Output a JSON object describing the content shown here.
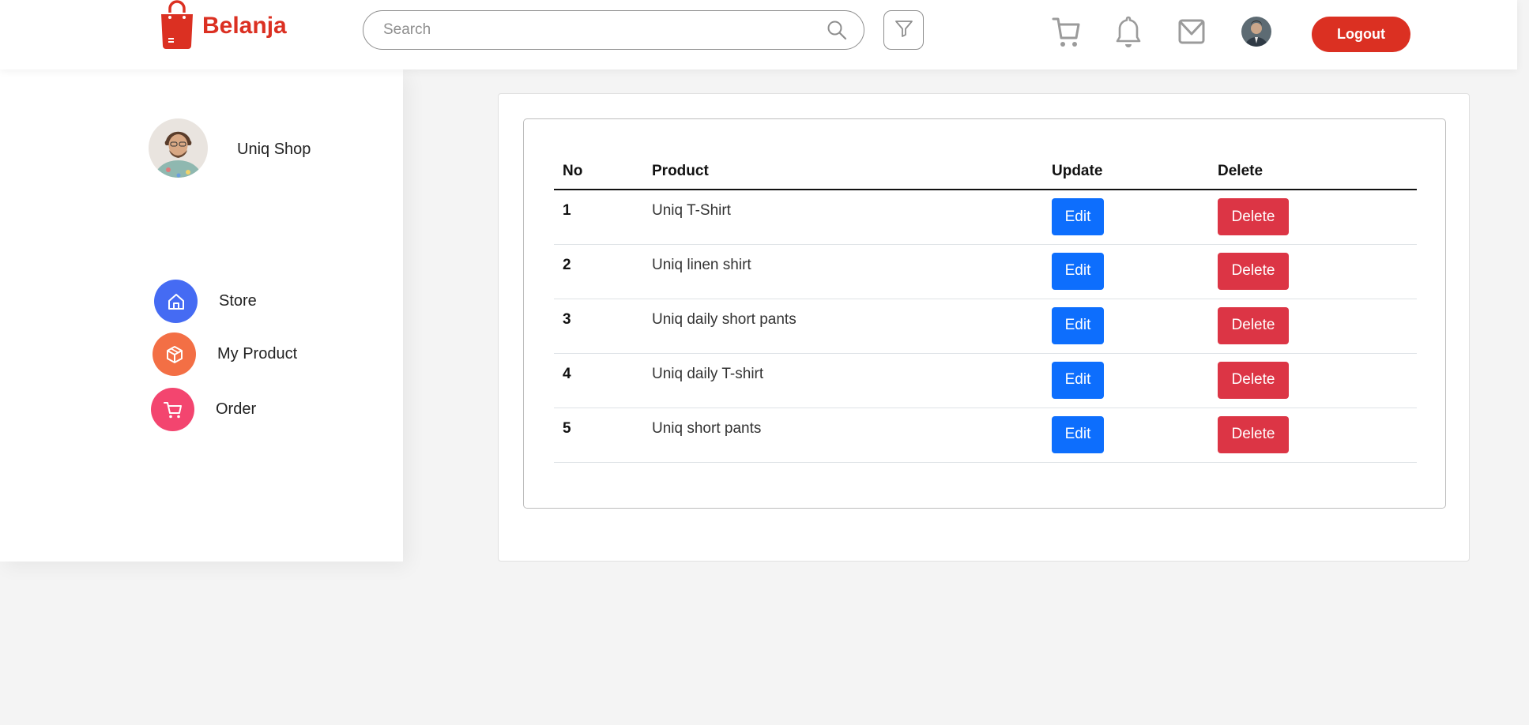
{
  "brand": {
    "name": "Belanja",
    "color": "#DB3022"
  },
  "search": {
    "placeholder": "Search",
    "value": ""
  },
  "nav": {
    "icons": [
      "cart-icon",
      "bell-icon",
      "mail-icon"
    ],
    "logout_label": "Logout"
  },
  "sidebar": {
    "profile_name": "Uniq Shop",
    "items": [
      {
        "label": "Store",
        "icon": "home-icon",
        "color": "#456BF3"
      },
      {
        "label": "My Product",
        "icon": "package-icon",
        "color": "#F36F45"
      },
      {
        "label": "Order",
        "icon": "cart-icon",
        "color": "#F3456F"
      }
    ]
  },
  "table": {
    "headers": {
      "no": "No",
      "product": "Product",
      "update": "Update",
      "delete": "Delete"
    },
    "rows": [
      {
        "no": "1",
        "product": "Uniq T-Shirt",
        "edit": "Edit",
        "delete": "Delete"
      },
      {
        "no": "2",
        "product": "Uniq linen shirt",
        "edit": "Edit",
        "delete": "Delete"
      },
      {
        "no": "3",
        "product": "Uniq daily short pants",
        "edit": "Edit",
        "delete": "Delete"
      },
      {
        "no": "4",
        "product": "Uniq daily T-shirt",
        "edit": "Edit",
        "delete": "Delete"
      },
      {
        "no": "5",
        "product": "Uniq short pants",
        "edit": "Edit",
        "delete": "Delete"
      }
    ]
  },
  "colors": {
    "edit_button": "#0d6efd",
    "delete_button": "#dc3545",
    "logout_button": "#DB3022"
  }
}
